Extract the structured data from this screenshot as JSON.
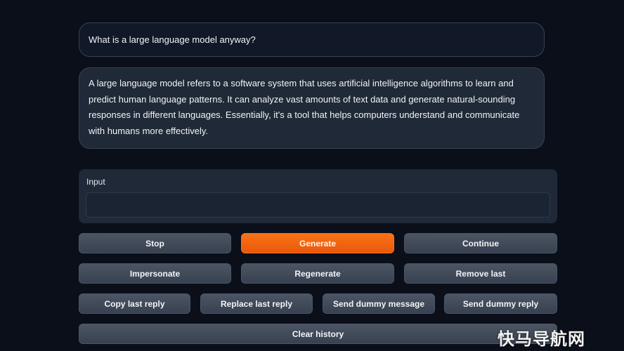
{
  "chat": {
    "user_message": "What is a large language model anyway?",
    "bot_message": "A large language model refers to a software system that uses artificial intelligence algorithms to learn and predict human language patterns. It can analyze vast amounts of text data and generate natural-sounding responses in different languages. Essentially, it's a tool that helps computers understand and communicate with humans more effectively."
  },
  "input": {
    "label": "Input",
    "value": "",
    "placeholder": ""
  },
  "buttons": {
    "stop": "Stop",
    "generate": "Generate",
    "continue": "Continue",
    "impersonate": "Impersonate",
    "regenerate": "Regenerate",
    "remove_last": "Remove last",
    "copy_last_reply": "Copy last reply",
    "replace_last_reply": "Replace last reply",
    "send_dummy_message": "Send dummy message",
    "send_dummy_reply": "Send dummy reply",
    "clear_history": "Clear history"
  },
  "watermark": "快马导航网",
  "colors": {
    "background": "#0b0f19",
    "accent": "#f97316",
    "button": "#4b5563"
  }
}
